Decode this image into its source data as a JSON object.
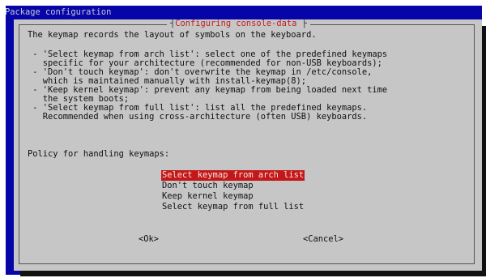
{
  "window": {
    "title": "Package configuration"
  },
  "dialog": {
    "title": "Configuring console-data",
    "intro": "The keymap records the layout of symbols on the keyboard.",
    "options_text": [
      " - 'Select keymap from arch list': select one of the predefined keymaps",
      "   specific for your architecture (recommended for non-USB keyboards);",
      " - 'Don't touch keymap': don't overwrite the keymap in /etc/console,",
      "   which is maintained manually with install-keymap(8);",
      " - 'Keep kernel keymap': prevent any keymap from being loaded next time",
      "   the system boots;",
      " - 'Select keymap from full list': list all the predefined keymaps.",
      "   Recommended when using cross-architecture (often USB) keyboards."
    ],
    "prompt": "Policy for handling keymaps:",
    "menu": [
      {
        "label": "Select keymap from arch list",
        "selected": true
      },
      {
        "label": "Don't touch keymap",
        "selected": false
      },
      {
        "label": "Keep kernel keymap",
        "selected": false
      },
      {
        "label": "Select keymap from full list",
        "selected": false
      }
    ],
    "buttons": {
      "ok": "<Ok>",
      "cancel": "<Cancel>"
    }
  },
  "colors": {
    "backdrop": "#0505a8",
    "dialog_bg": "#c6c6c6",
    "title_text": "#c42020",
    "selection_bg": "#c41818"
  }
}
